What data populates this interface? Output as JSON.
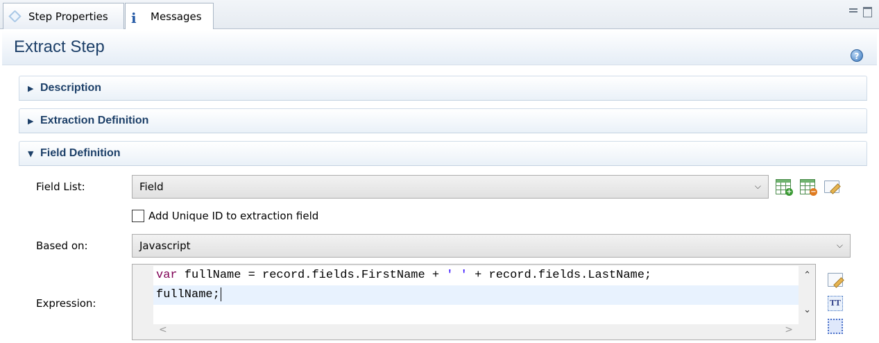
{
  "tabs": [
    {
      "label": "Step Properties",
      "icon": "tag-icon",
      "active": true
    },
    {
      "label": "Messages",
      "icon": "info-icon",
      "active": false
    }
  ],
  "header": {
    "title": "Extract Step",
    "help_icon": "help-icon"
  },
  "sections": [
    {
      "title": "Description",
      "expanded": false
    },
    {
      "title": "Extraction Definition",
      "expanded": false
    },
    {
      "title": "Field Definition",
      "expanded": true
    }
  ],
  "form": {
    "field_list": {
      "label": "Field List:",
      "value": "Field"
    },
    "checkbox": {
      "label": "Add Unique ID to extraction field",
      "checked": false
    },
    "based_on": {
      "label": "Based on:",
      "value": "Javascript"
    },
    "expression": {
      "label": "Expression:",
      "lines": [
        {
          "kw": "var",
          "a": " fullName = record.fields.FirstName + ",
          "str": "' '",
          "b": " + record.fields.LastName;"
        },
        {
          "text": "fullName;"
        }
      ]
    }
  }
}
